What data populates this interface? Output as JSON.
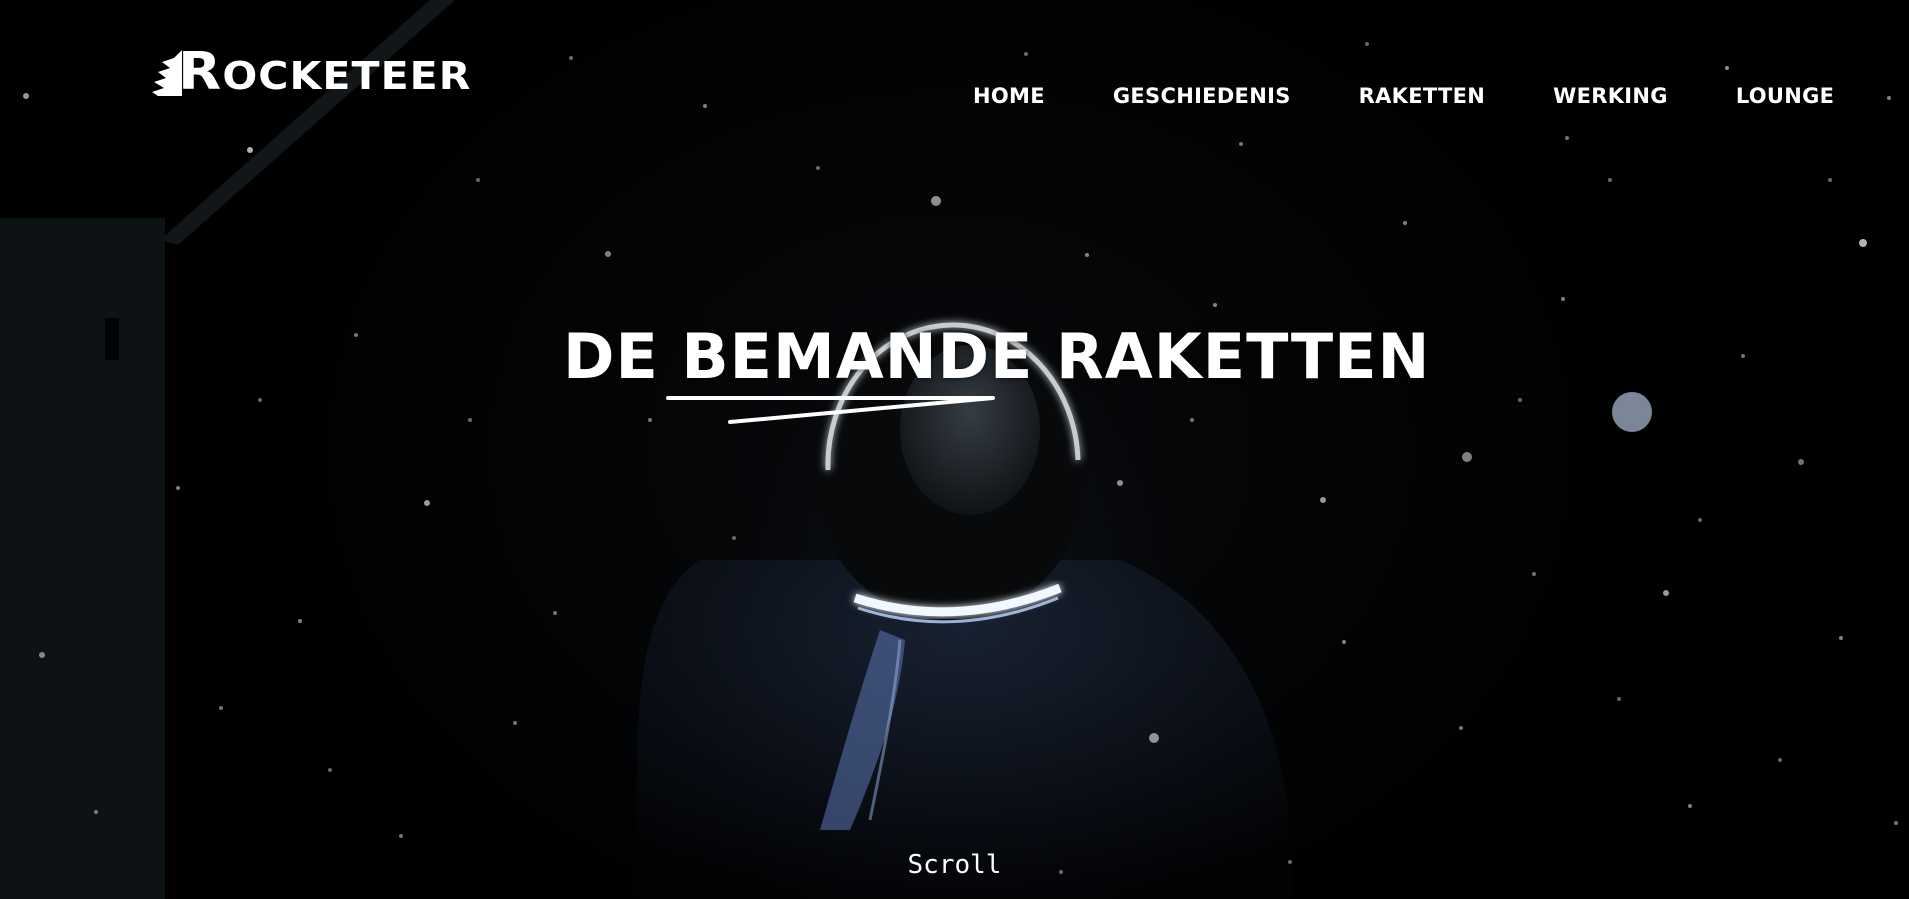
{
  "logo": {
    "first_letter": "R",
    "rest": "OCKETEER"
  },
  "nav": {
    "items": [
      {
        "label": "HOME"
      },
      {
        "label": "GESCHIEDENIS"
      },
      {
        "label": "RAKETTEN"
      },
      {
        "label": "WERKING"
      },
      {
        "label": "LOUNGE"
      }
    ]
  },
  "hero": {
    "title": "DE BEMANDE RAKETTEN",
    "scroll_label": "Scroll"
  },
  "colors": {
    "background": "#000000",
    "text": "#ffffff",
    "helmet_glow": "#e6f2ff",
    "planet": "#7b8796"
  },
  "icons": {
    "logo_mark": "rocket-flame-icon"
  }
}
